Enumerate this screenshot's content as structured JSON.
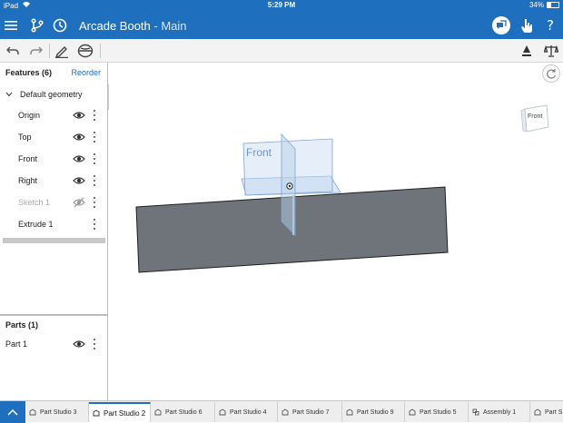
{
  "status_bar": {
    "device": "iPad",
    "time": "5:29 PM",
    "battery": "34%"
  },
  "app_bar": {
    "doc_name": "Arcade Booth",
    "separator": " - ",
    "workspace": "Main"
  },
  "toolbar": {
    "icons": [
      "undo-icon",
      "redo-icon",
      "sketch-pencil-icon",
      "plane-icon",
      "measure-icon",
      "mass-properties-icon"
    ]
  },
  "features_panel": {
    "title": "Features (6)",
    "reorder_label": "Reorder",
    "group_label": "Default geometry",
    "items": [
      {
        "label": "Origin",
        "hidden": false
      },
      {
        "label": "Top",
        "hidden": false
      },
      {
        "label": "Front",
        "hidden": false
      },
      {
        "label": "Right",
        "hidden": false
      },
      {
        "label": "Sketch 1",
        "hidden": true
      },
      {
        "label": "Extrude 1",
        "hidden": false
      }
    ]
  },
  "parts_panel": {
    "title": "Parts (1)",
    "items": [
      {
        "label": "Part 1"
      }
    ]
  },
  "viewport": {
    "plane_label": "Front",
    "view_cube_label": "Front",
    "part_color": "#6e7479"
  },
  "tabs": [
    {
      "label": "Part Studio 3",
      "active": false
    },
    {
      "label": "Part Studio 2",
      "active": true
    },
    {
      "label": "Part Studio 6",
      "active": false
    },
    {
      "label": "Part Studio 4",
      "active": false
    },
    {
      "label": "Part Studio 7",
      "active": false
    },
    {
      "label": "Part Studio 9",
      "active": false
    },
    {
      "label": "Part Studio 5",
      "active": false
    },
    {
      "label": "Assembly 1",
      "active": false
    },
    {
      "label": "Part S",
      "active": false
    }
  ],
  "colors": {
    "accent": "#1f6fbf",
    "part": "#6e7479",
    "plane": "#8fb4dd"
  }
}
